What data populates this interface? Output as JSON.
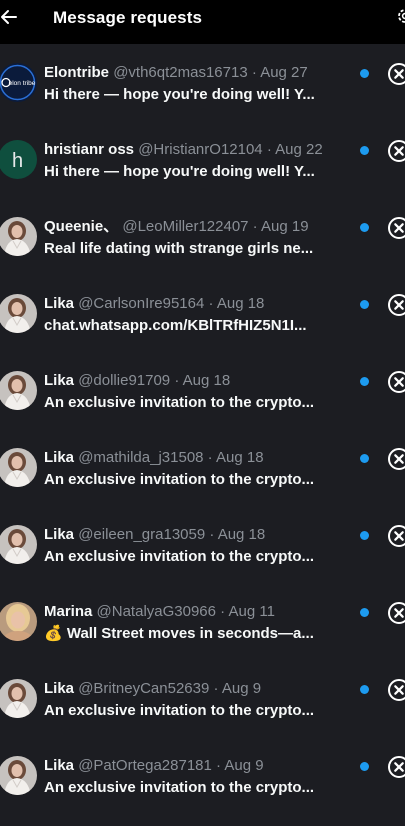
{
  "header": {
    "title": "Message requests",
    "back_icon": "arrow-left-icon",
    "settings_icon": "gear-icon"
  },
  "colors": {
    "background": "#1c1d22",
    "header": "#000000",
    "unread": "#1d9bf0",
    "muted": "#8b9097",
    "text": "#f7f9f9"
  },
  "requests": [
    {
      "name": "Elontribe",
      "handle": "@vth6qt2mas16713",
      "date": "Aug 27",
      "preview": "Hi there — hope you're doing well! Y...",
      "avatar": "elon-tribe-logo",
      "initial": "",
      "avatar_text": "elon tribe"
    },
    {
      "name": "hristianr oss",
      "handle": "@HristianrO12104",
      "date": "Aug 22",
      "preview": "Hi there — hope you're doing well! Y...",
      "avatar": "initial",
      "initial": "h",
      "avatar_text": ""
    },
    {
      "name": "Queenie、",
      "handle": "@LeoMiller122407",
      "date": "Aug 19",
      "preview": "Real life dating with strange girls ne...",
      "avatar": "photo",
      "initial": "",
      "avatar_text": ""
    },
    {
      "name": "Lika",
      "handle": "@CarlsonIre95164",
      "date": "Aug 18",
      "preview": "chat.whatsapp.com/KBlTRfHIZ5N1I...",
      "avatar": "photo",
      "initial": "",
      "avatar_text": ""
    },
    {
      "name": "Lika",
      "handle": "@dollie91709",
      "date": "Aug 18",
      "preview": "An exclusive invitation to the crypto...",
      "avatar": "photo",
      "initial": "",
      "avatar_text": ""
    },
    {
      "name": "Lika",
      "handle": "@mathilda_j31508",
      "date": "Aug 18",
      "preview": "An exclusive invitation to the crypto...",
      "avatar": "photo",
      "initial": "",
      "avatar_text": ""
    },
    {
      "name": "Lika",
      "handle": "@eileen_gra13059",
      "date": "Aug 18",
      "preview": "An exclusive invitation to the crypto...",
      "avatar": "photo",
      "initial": "",
      "avatar_text": ""
    },
    {
      "name": "Marina",
      "handle": "@NatalyaG30966",
      "date": "Aug 11",
      "preview": "💰 Wall Street moves in seconds—a...",
      "avatar": "photo-blonde",
      "initial": "",
      "avatar_text": ""
    },
    {
      "name": "Lika",
      "handle": "@BritneyCan52639",
      "date": "Aug 9",
      "preview": "An exclusive invitation to the crypto...",
      "avatar": "photo",
      "initial": "",
      "avatar_text": ""
    },
    {
      "name": "Lika",
      "handle": "@PatOrtega287181",
      "date": "Aug 9",
      "preview": "An exclusive invitation to the crypto...",
      "avatar": "photo",
      "initial": "",
      "avatar_text": ""
    }
  ]
}
